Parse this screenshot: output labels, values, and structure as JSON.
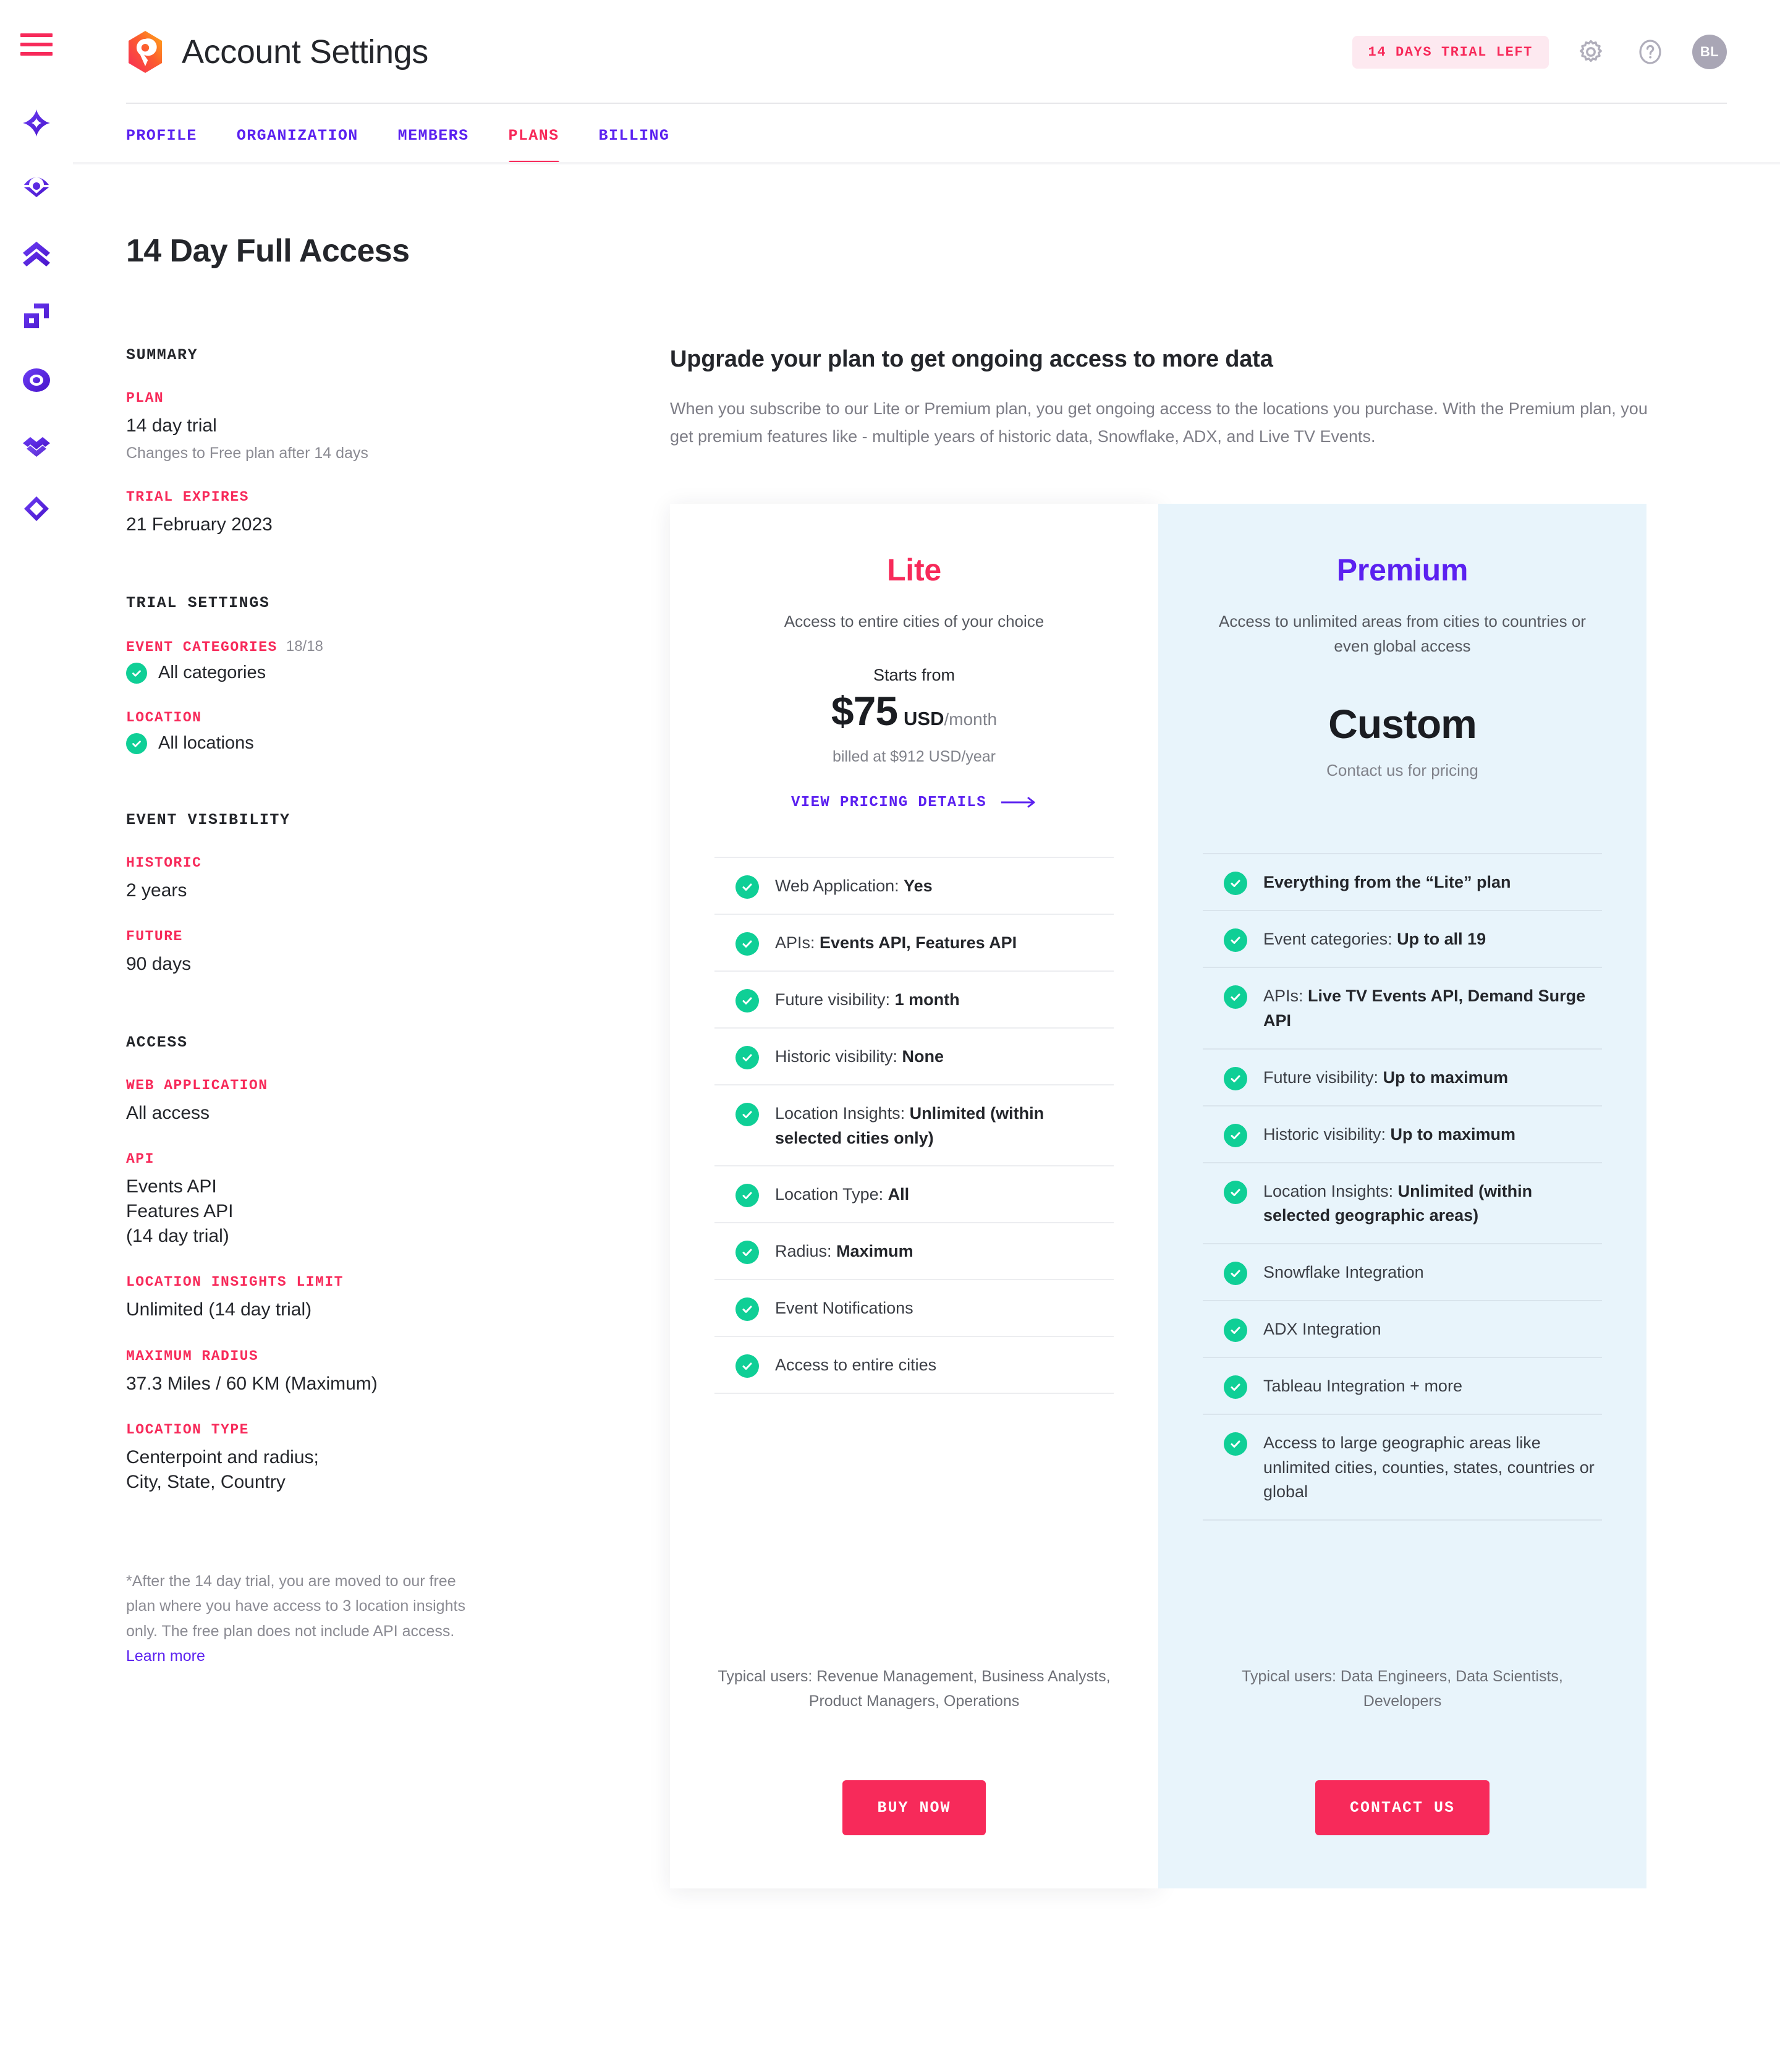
{
  "colors": {
    "pink": "#f72a5a",
    "purple": "#5b21f0",
    "green": "#0fcf96",
    "premium_card_bg": "#e8f4fb",
    "trial_badge_bg": "#fde9f0",
    "avatar_bg": "#a9a6b5"
  },
  "rail": {
    "items": [
      {
        "name": "menu-toggle"
      },
      {
        "name": "sparkle"
      },
      {
        "name": "insight-eye"
      },
      {
        "name": "chevrons-up"
      },
      {
        "name": "layers"
      },
      {
        "name": "target"
      },
      {
        "name": "wave"
      },
      {
        "name": "diamond"
      }
    ]
  },
  "header": {
    "logo_alt": "location-pin-logo",
    "title": "Account Settings",
    "trial_badge": "14 DAYS TRIAL LEFT",
    "gear_icon": "gear-icon",
    "help_icon": "question-icon",
    "avatar_initials": "BL"
  },
  "tabs": [
    {
      "label": "PROFILE",
      "active": false
    },
    {
      "label": "ORGANIZATION",
      "active": false
    },
    {
      "label": "MEMBERS",
      "active": false
    },
    {
      "label": "PLANS",
      "active": true
    },
    {
      "label": "BILLING",
      "active": false
    }
  ],
  "page": {
    "title": "14 Day Full Access"
  },
  "summary": {
    "heading": "SUMMARY",
    "plan_label": "PLAN",
    "plan_value": "14 day trial",
    "plan_sub": "Changes to Free plan after 14 days",
    "expires_label": "TRIAL EXPIRES",
    "expires_value": "21 February 2023"
  },
  "trial_settings": {
    "heading": "TRIAL SETTINGS",
    "categories_label": "EVENT CATEGORIES",
    "categories_count": "18/18",
    "categories_value": "All categories",
    "location_label": "LOCATION",
    "location_value": "All locations"
  },
  "event_visibility": {
    "heading": "EVENT VISIBILITY",
    "historic_label": "HISTORIC",
    "historic_value": "2 years",
    "future_label": "FUTURE",
    "future_value": "90 days"
  },
  "access": {
    "heading": "ACCESS",
    "web_label": "WEB APPLICATION",
    "web_value": "All access",
    "api_label": "API",
    "api_value": "Events API\nFeatures API\n(14 day trial)",
    "insights_label": "LOCATION INSIGHTS LIMIT",
    "insights_value": "Unlimited (14 day trial)",
    "radius_label": "MAXIMUM RADIUS",
    "radius_value": "37.3 Miles / 60 KM (Maximum)",
    "loctype_label": "LOCATION TYPE",
    "loctype_value": "Centerpoint and radius;\nCity, State, Country"
  },
  "footnote": {
    "text": "*After the 14 day trial, you are moved to our free plan where you have access to 3 location insights only. The free plan does not include API access. ",
    "link": "Learn more"
  },
  "upsell": {
    "heading": "Upgrade your plan to get ongoing access to more data",
    "intro": "When you subscribe to our Lite or Premium plan, you get ongoing access to the locations you purchase. With the Premium plan, you get premium features like - multiple years of historic data, Snowflake, ADX, and Live TV Events."
  },
  "plans": {
    "lite": {
      "name": "Lite",
      "tagline": "Access to entire cities of your choice",
      "price_lead": "Starts from",
      "price_amount": "$75",
      "price_currency": "USD",
      "price_period": "/month",
      "price_billed": "billed at $912 USD/year",
      "pricing_link": "VIEW PRICING DETAILS",
      "features": [
        {
          "label": "Web Application: ",
          "bold": "Yes"
        },
        {
          "label": "APIs: ",
          "bold": "Events API, Features API"
        },
        {
          "label": "Future visibility: ",
          "bold": "1 month"
        },
        {
          "label": "Historic visibility: ",
          "bold": "None"
        },
        {
          "label": "Location Insights: ",
          "bold": "Unlimited (within selected cities only)"
        },
        {
          "label": "Location Type: ",
          "bold": "All"
        },
        {
          "label": "Radius: ",
          "bold": "Maximum"
        },
        {
          "label": "Event Notifications",
          "bold": ""
        },
        {
          "label": "Access to entire cities",
          "bold": ""
        }
      ],
      "typical_users": "Typical users: Revenue Management, Business Analysts, Product Managers, Operations",
      "cta": "BUY NOW"
    },
    "premium": {
      "name": "Premium",
      "tagline": "Access to unlimited areas from cities to countries or even global access",
      "price_custom": "Custom",
      "price_custom_sub": "Contact us for pricing",
      "features": [
        {
          "label": "",
          "bold": "Everything from the “Lite” plan"
        },
        {
          "label": "Event categories: ",
          "bold": "Up to all 19"
        },
        {
          "label": "APIs: ",
          "bold": "Live TV Events API, Demand Surge API"
        },
        {
          "label": "Future visibility: ",
          "bold": "Up to maximum"
        },
        {
          "label": "Historic visibility: ",
          "bold": "Up to maximum"
        },
        {
          "label": "Location Insights: ",
          "bold": "Unlimited (within selected geographic areas)"
        },
        {
          "label": "Snowflake Integration",
          "bold": ""
        },
        {
          "label": "ADX Integration",
          "bold": ""
        },
        {
          "label": "Tableau Integration + more",
          "bold": ""
        },
        {
          "label": "Access to large geographic areas like unlimited cities, counties, states, countries or global",
          "bold": ""
        }
      ],
      "typical_users": "Typical users: Data Engineers, Data Scientists, Developers",
      "cta": "CONTACT US"
    }
  }
}
